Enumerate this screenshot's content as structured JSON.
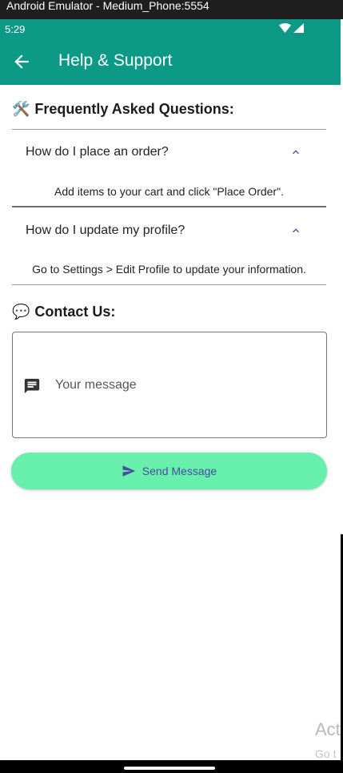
{
  "window": {
    "title": "Android Emulator - Medium_Phone:5554"
  },
  "status_bar": {
    "time": "5:29",
    "icons": [
      "wifi-icon",
      "signal-icon"
    ]
  },
  "app_bar": {
    "title": "Help & Support",
    "back_icon": "arrow-back-icon"
  },
  "faq": {
    "heading": "Frequently Asked Questions:",
    "heading_emoji": "🛠️",
    "items": [
      {
        "question": "How do I place an order?",
        "answer": "Add items to your cart and click \"Place Order\".",
        "expanded": true
      },
      {
        "question": "How do I update my profile?",
        "answer": "Go to Settings > Edit Profile to update your information.",
        "expanded": true
      }
    ]
  },
  "contact": {
    "heading": "Contact Us:",
    "heading_emoji": "💬",
    "message_placeholder": "Your message",
    "message_value": "",
    "send_label": "Send Message"
  },
  "watermark": {
    "line1": "Act",
    "line2": "Go t"
  },
  "colors": {
    "primary": "#0c9a86",
    "button": "#67f0ac",
    "button_text": "#4a4aa0",
    "chevron": "#4a4aa0"
  }
}
